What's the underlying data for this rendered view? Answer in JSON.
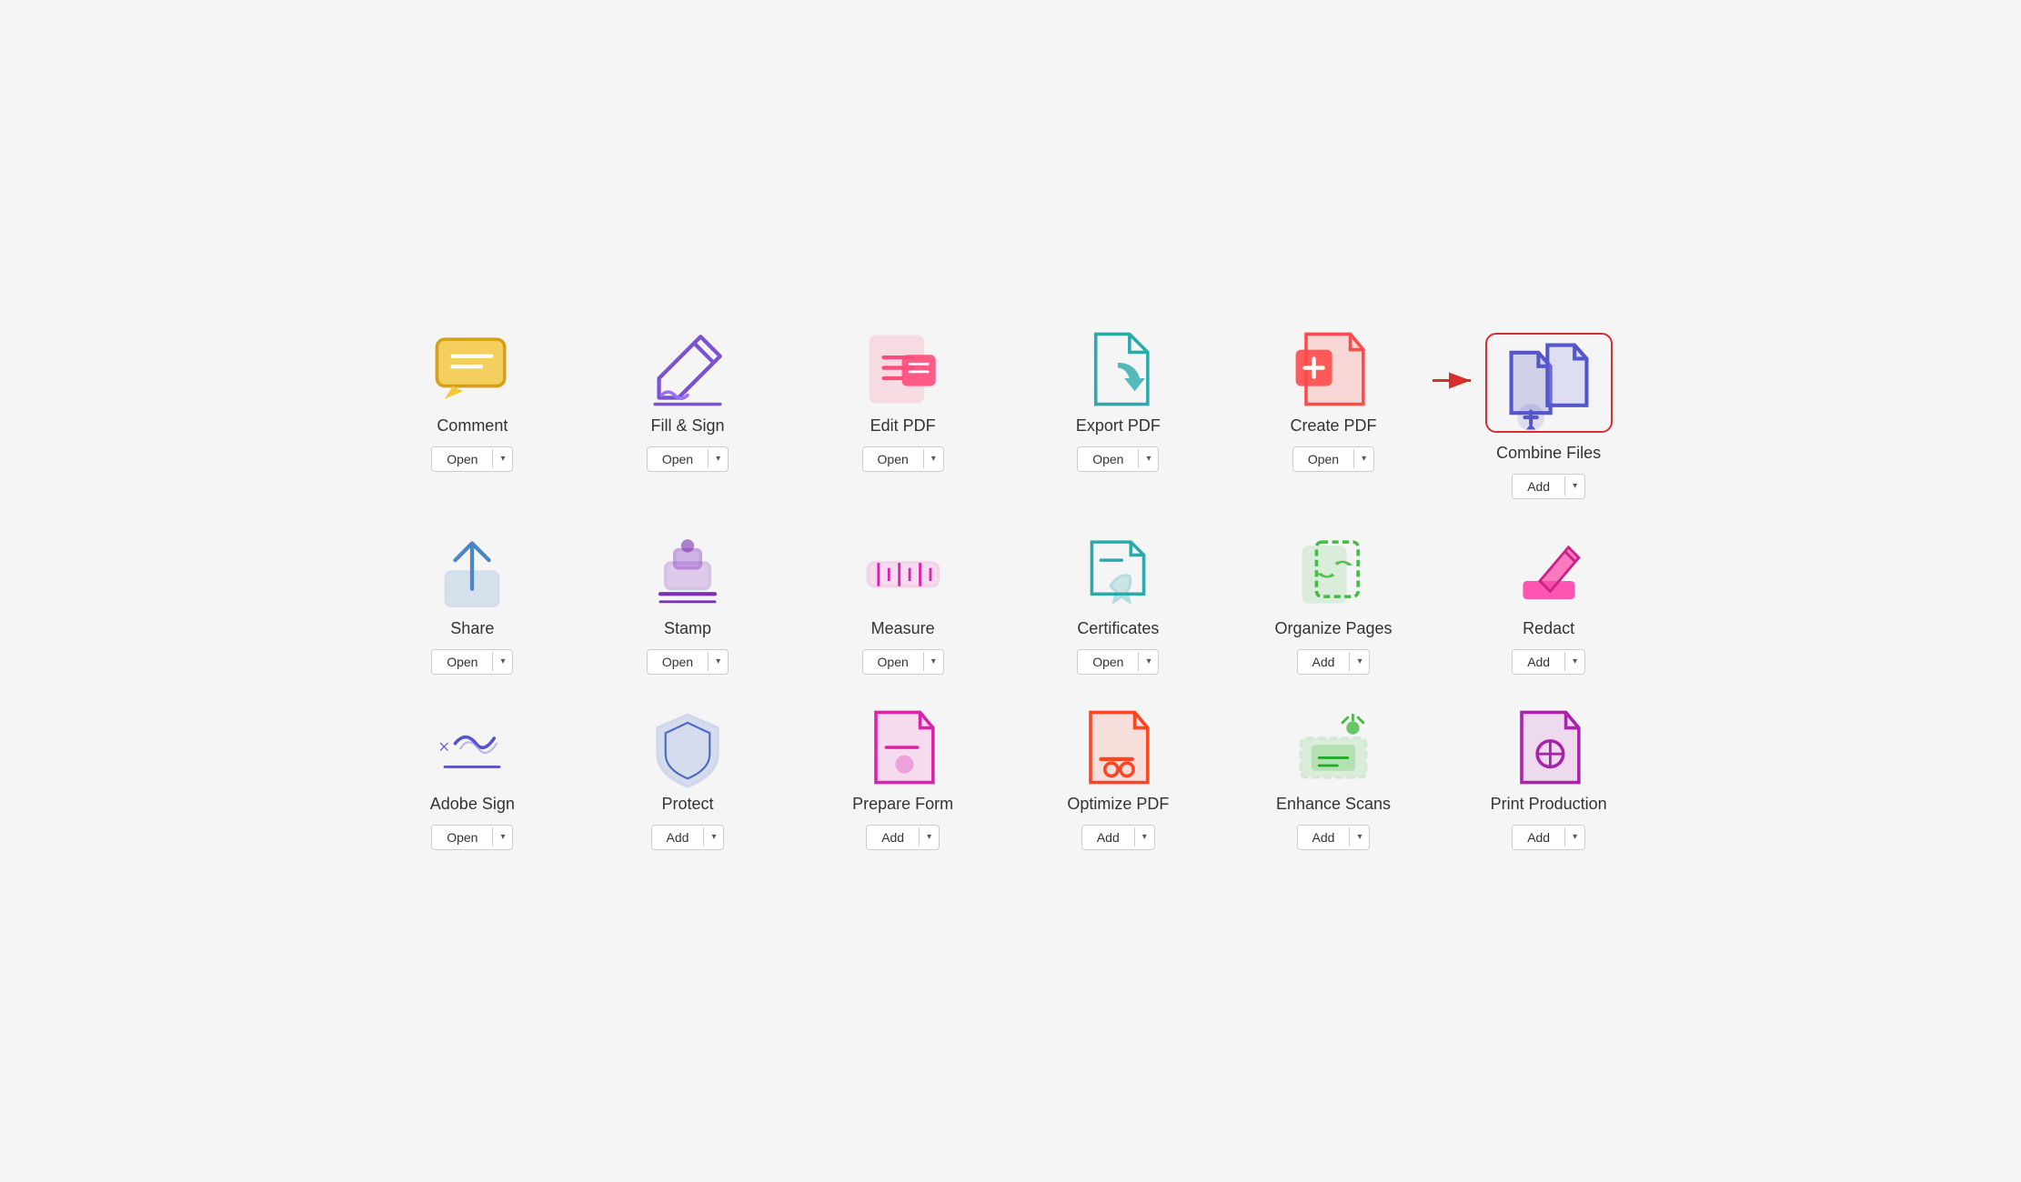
{
  "tools": [
    {
      "id": "comment",
      "name": "Comment",
      "btn_label": "Open",
      "highlighted": false,
      "icon_type": "comment"
    },
    {
      "id": "fill-sign",
      "name": "Fill & Sign",
      "btn_label": "Open",
      "highlighted": false,
      "icon_type": "fill-sign"
    },
    {
      "id": "edit-pdf",
      "name": "Edit PDF",
      "btn_label": "Open",
      "highlighted": false,
      "icon_type": "edit-pdf"
    },
    {
      "id": "export-pdf",
      "name": "Export PDF",
      "btn_label": "Open",
      "highlighted": false,
      "icon_type": "export-pdf"
    },
    {
      "id": "create-pdf",
      "name": "Create PDF",
      "btn_label": "Open",
      "highlighted": false,
      "icon_type": "create-pdf"
    },
    {
      "id": "combine-files",
      "name": "Combine Files",
      "btn_label": "Add",
      "highlighted": true,
      "has_arrow": true,
      "icon_type": "combine-files"
    },
    {
      "id": "share",
      "name": "Share",
      "btn_label": "Open",
      "highlighted": false,
      "icon_type": "share"
    },
    {
      "id": "stamp",
      "name": "Stamp",
      "btn_label": "Open",
      "highlighted": false,
      "icon_type": "stamp"
    },
    {
      "id": "measure",
      "name": "Measure",
      "btn_label": "Open",
      "highlighted": false,
      "icon_type": "measure"
    },
    {
      "id": "certificates",
      "name": "Certificates",
      "btn_label": "Open",
      "highlighted": false,
      "icon_type": "certificates"
    },
    {
      "id": "organize-pages",
      "name": "Organize Pages",
      "btn_label": "Add",
      "highlighted": false,
      "icon_type": "organize-pages"
    },
    {
      "id": "redact",
      "name": "Redact",
      "btn_label": "Add",
      "highlighted": false,
      "icon_type": "redact"
    },
    {
      "id": "adobe-sign",
      "name": "Adobe Sign",
      "btn_label": "Open",
      "highlighted": false,
      "icon_type": "adobe-sign"
    },
    {
      "id": "protect",
      "name": "Protect",
      "btn_label": "Add",
      "highlighted": false,
      "icon_type": "protect"
    },
    {
      "id": "prepare-form",
      "name": "Prepare Form",
      "btn_label": "Add",
      "highlighted": false,
      "icon_type": "prepare-form"
    },
    {
      "id": "optimize-pdf",
      "name": "Optimize PDF",
      "btn_label": "Add",
      "highlighted": false,
      "icon_type": "optimize-pdf"
    },
    {
      "id": "enhance-scans",
      "name": "Enhance Scans",
      "btn_label": "Add",
      "highlighted": false,
      "icon_type": "enhance-scans"
    },
    {
      "id": "print-production",
      "name": "Print Production",
      "btn_label": "Add",
      "highlighted": false,
      "icon_type": "print-production"
    }
  ],
  "dropdown_char": "▾"
}
